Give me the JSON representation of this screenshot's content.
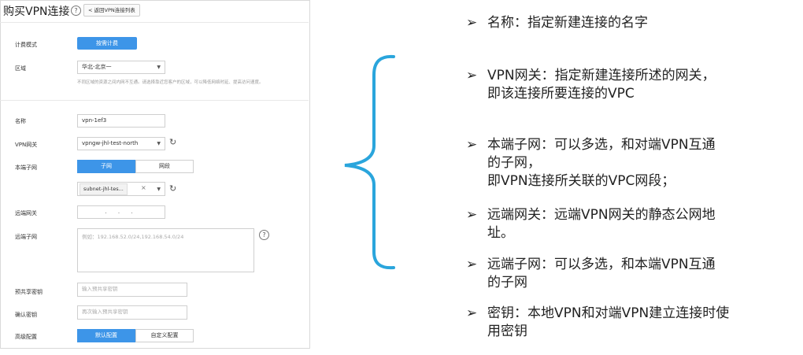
{
  "header": {
    "title": "购买VPN连接",
    "help_icon": "?",
    "back_label": "< 返回VPN连接列表"
  },
  "billing": {
    "label": "计费模式",
    "button": "按需计费"
  },
  "region": {
    "label": "区域",
    "value": "华北-北京一",
    "hint": "不同区域的资源之间内网不互通。请选择靠近您客户的区域，可以降低网络时延、提高访问速度。"
  },
  "name": {
    "label": "名称",
    "value": "vpn-1ef3"
  },
  "gateway": {
    "label": "VPN网关",
    "value": "vpngw-jhl-test-north"
  },
  "local_subnet": {
    "label": "本端子网",
    "tabs": [
      "子网",
      "网段"
    ],
    "selected_tag": "subnet-jhl-tes...",
    "tag_close": "×"
  },
  "remote_gateway": {
    "label": "远端网关",
    "value": ". . ."
  },
  "remote_subnet": {
    "label": "远端子网",
    "placeholder": "例如：192.168.52.0/24,192.168.54.0/24"
  },
  "psk": {
    "label": "预共享密钥",
    "placeholder": "输入预共享密钥"
  },
  "confirm_key": {
    "label": "确认密钥",
    "placeholder": "再次输入预共享密钥"
  },
  "advanced": {
    "label": "高级配置",
    "tabs": [
      "默认配置",
      "自定义配置"
    ]
  },
  "bullet_symbol": "➢",
  "notes": {
    "n1": [
      "名称：指定新建连接的名字"
    ],
    "n2": [
      "VPN网关：指定新建连接所述的网关，",
      "即该连接所要连接的VPC"
    ],
    "n3": [
      "本端子网：可以多选，和对端VPN互通",
      "的子网，",
      "即VPN连接所关联的VPC网段；"
    ],
    "n4": [
      "远端网关：远端VPN网关的静态公网地",
      "址。"
    ],
    "n5": [
      "远端子网：可以多选，和本端VPN互通",
      "的子网"
    ],
    "n6": [
      "密钥：本地VPN和对端VPN建立连接时使",
      "用密钥"
    ]
  },
  "colors": {
    "accent": "#3d95e8",
    "brace": "#2aa5dc"
  }
}
